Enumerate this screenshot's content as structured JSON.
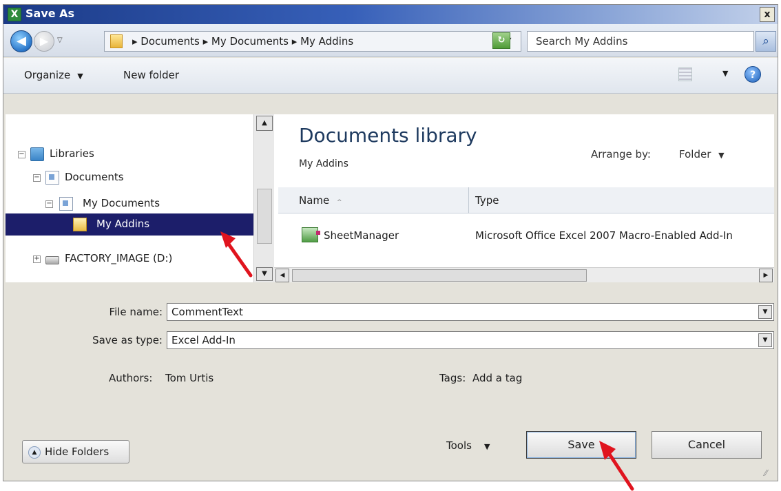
{
  "window": {
    "title": "Save As",
    "close": "x"
  },
  "addressbar": {
    "breadcrumb": "▸ Documents ▸ My Documents ▸ My Addins",
    "search_placeholder": "Search My Addins"
  },
  "toolbar": {
    "organize": "Organize",
    "new_folder": "New folder",
    "help": "?"
  },
  "nav": {
    "items": [
      {
        "label": "Libraries",
        "expander": "−"
      },
      {
        "label": "Documents",
        "expander": "−"
      },
      {
        "label": "My Documents",
        "expander": "−"
      },
      {
        "label": "My Addins",
        "selected": true
      },
      {
        "label": "FACTORY_IMAGE (D:)",
        "expander": "+"
      }
    ]
  },
  "library": {
    "title": "Documents library",
    "subtitle": "My Addins",
    "arrange_label": "Arrange by:",
    "arrange_value": "Folder",
    "columns": {
      "name": "Name",
      "type": "Type"
    },
    "files": [
      {
        "name": "SheetManager",
        "type": "Microsoft Office Excel 2007 Macro-Enabled Add-In"
      }
    ]
  },
  "form": {
    "file_name_label": "File name:",
    "file_name_value": "CommentText",
    "save_type_label": "Save as type:",
    "save_type_value": "Excel Add-In",
    "authors_label": "Authors:",
    "authors_value": "Tom Urtis",
    "tags_label": "Tags:",
    "tags_value": "Add a tag"
  },
  "buttons": {
    "hide_folders": "Hide Folders",
    "tools": "Tools",
    "save": "Save",
    "cancel": "Cancel"
  },
  "colors": {
    "selection": "#1c1e6a",
    "title_bar": "#1b3a87",
    "annotation_arrow": "#e0141e"
  }
}
